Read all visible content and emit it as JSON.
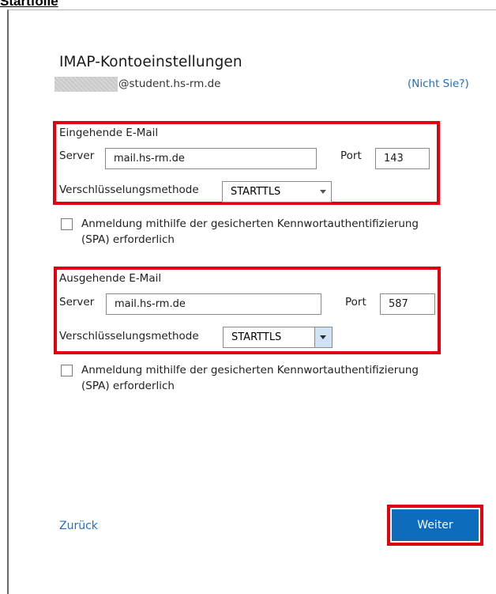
{
  "page_caption": "Startfolie",
  "dialog": {
    "title": "IMAP-Kontoeinstellungen",
    "email_suffix": "@student.hs-rm.de",
    "not_you_link": "(Nicht Sie?)"
  },
  "incoming": {
    "heading": "Eingehende E-Mail",
    "server_label": "Server",
    "server_value": "mail.hs-rm.de",
    "port_label": "Port",
    "port_value": "143",
    "encryption_label": "Verschlüsselungsmethode",
    "encryption_value": "STARTTLS"
  },
  "incoming_spa": {
    "checked": false,
    "line1": "Anmeldung mithilfe der gesicherten Kennwortauthentifizierung",
    "line2": "(SPA) erforderlich"
  },
  "outgoing": {
    "heading": "Ausgehende E-Mail",
    "server_label": "Server",
    "server_value": "mail.hs-rm.de",
    "port_label": "Port",
    "port_value": "587",
    "encryption_label": "Verschlüsselungsmethode",
    "encryption_value": "STARTTLS"
  },
  "outgoing_spa": {
    "checked": false,
    "line1": "Anmeldung mithilfe der gesicherten Kennwortauthentifizierung",
    "line2": "(SPA) erforderlich"
  },
  "footer": {
    "back_label": "Zurück",
    "next_label": "Weiter"
  },
  "colors": {
    "highlight_red": "#e3000f",
    "link_blue": "#1f6fbf",
    "button_blue": "#0f6cbd"
  }
}
